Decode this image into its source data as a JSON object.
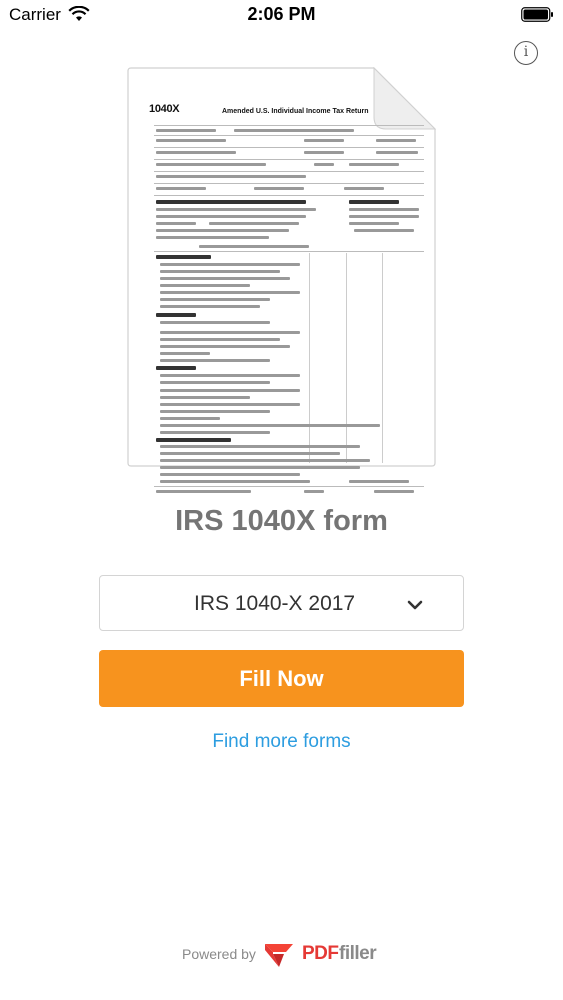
{
  "status_bar": {
    "carrier": "Carrier",
    "time": "2:06 PM"
  },
  "info_icon_glyph": "i",
  "preview": {
    "form_number": "1040X",
    "form_title": "Amended U.S. Individual Income Tax Return"
  },
  "form_name": "IRS 1040X form",
  "selector": {
    "value": "IRS 1040-X 2017"
  },
  "fill_button": {
    "label": "Fill Now"
  },
  "find_more_link": {
    "label": "Find more forms"
  },
  "footer": {
    "powered_by": "Powered by",
    "brand_pdf": "PDF",
    "brand_filler": "filler"
  },
  "colors": {
    "accent": "#f7931e",
    "link": "#2d9de0",
    "brand_red": "#e53935",
    "muted": "#8a8a8a"
  },
  "icons": [
    "wifi-icon",
    "battery-icon",
    "info-icon",
    "chevron-down-icon",
    "pdffiller-logo-icon"
  ]
}
